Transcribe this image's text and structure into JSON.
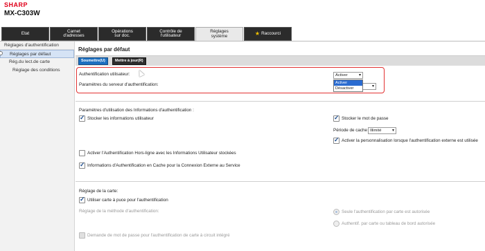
{
  "brand": "SHARP",
  "model": "MX-C303W",
  "tabs": [
    {
      "l1": "Etat",
      "l2": ""
    },
    {
      "l1": "Carnet",
      "l2": "d'adresses"
    },
    {
      "l1": "Opérations",
      "l2": "sur doc."
    },
    {
      "l1": "Contrôle de",
      "l2": "l'utilisateur"
    },
    {
      "l1": "Réglages",
      "l2": "système"
    },
    {
      "l1": "Raccourci",
      "l2": ""
    }
  ],
  "sidebar": {
    "header": "Réglages d'authentification",
    "items": [
      {
        "label": "Réglages par défaut"
      },
      {
        "label": "Rég.du lect.de carte"
      },
      {
        "label": "Réglage des conditions"
      }
    ]
  },
  "main": {
    "title": "Réglages par défaut",
    "toolbar": {
      "submit": "Soumettre(U)",
      "update": "Mettre à jour(R)"
    },
    "auth_user_label": "Authentification utilisateur:",
    "auth_user_value": "Activer",
    "auth_server_label": "Paramètres du serveur d'authentification:",
    "dropdown_options": [
      "Activer",
      "Désactiver"
    ],
    "info_section_label": "Paramètres d'utilisation des Informations d'authentification :",
    "store_user_info": "Stocker les informations utilisateur",
    "store_password": "Stocker le mot de passe",
    "cache_period_label": "Période de cache",
    "cache_period_value": "Illimité",
    "enable_personalization": "Activer la personnalisation lorsque l'authentification externe est utilisée",
    "offline_auth": "Activer l'Authentification Hors-ligne avec les Informations Utilisateur stockées",
    "cached_auth_info": "Informations d'Authentification en Cache pour la Connexion Externe au Service",
    "card_section_label": "Réglage de la carte:",
    "use_ic_card": "Utiliser carte à puce pour l'authentification",
    "auth_method_label": "Réglage de la méthode d'authentification:",
    "card_only": "Seule l'authentification par carte est autorisée",
    "card_or_panel": "Authentif. par carte ou tableau de bord autorisée",
    "password_request": "Demande de mot de passe pour l'authentification de carte à circuit intégré"
  },
  "colors": {
    "accent": "#1d6fc0",
    "highlight_box": "#e23030",
    "brand": "#e0001a"
  }
}
